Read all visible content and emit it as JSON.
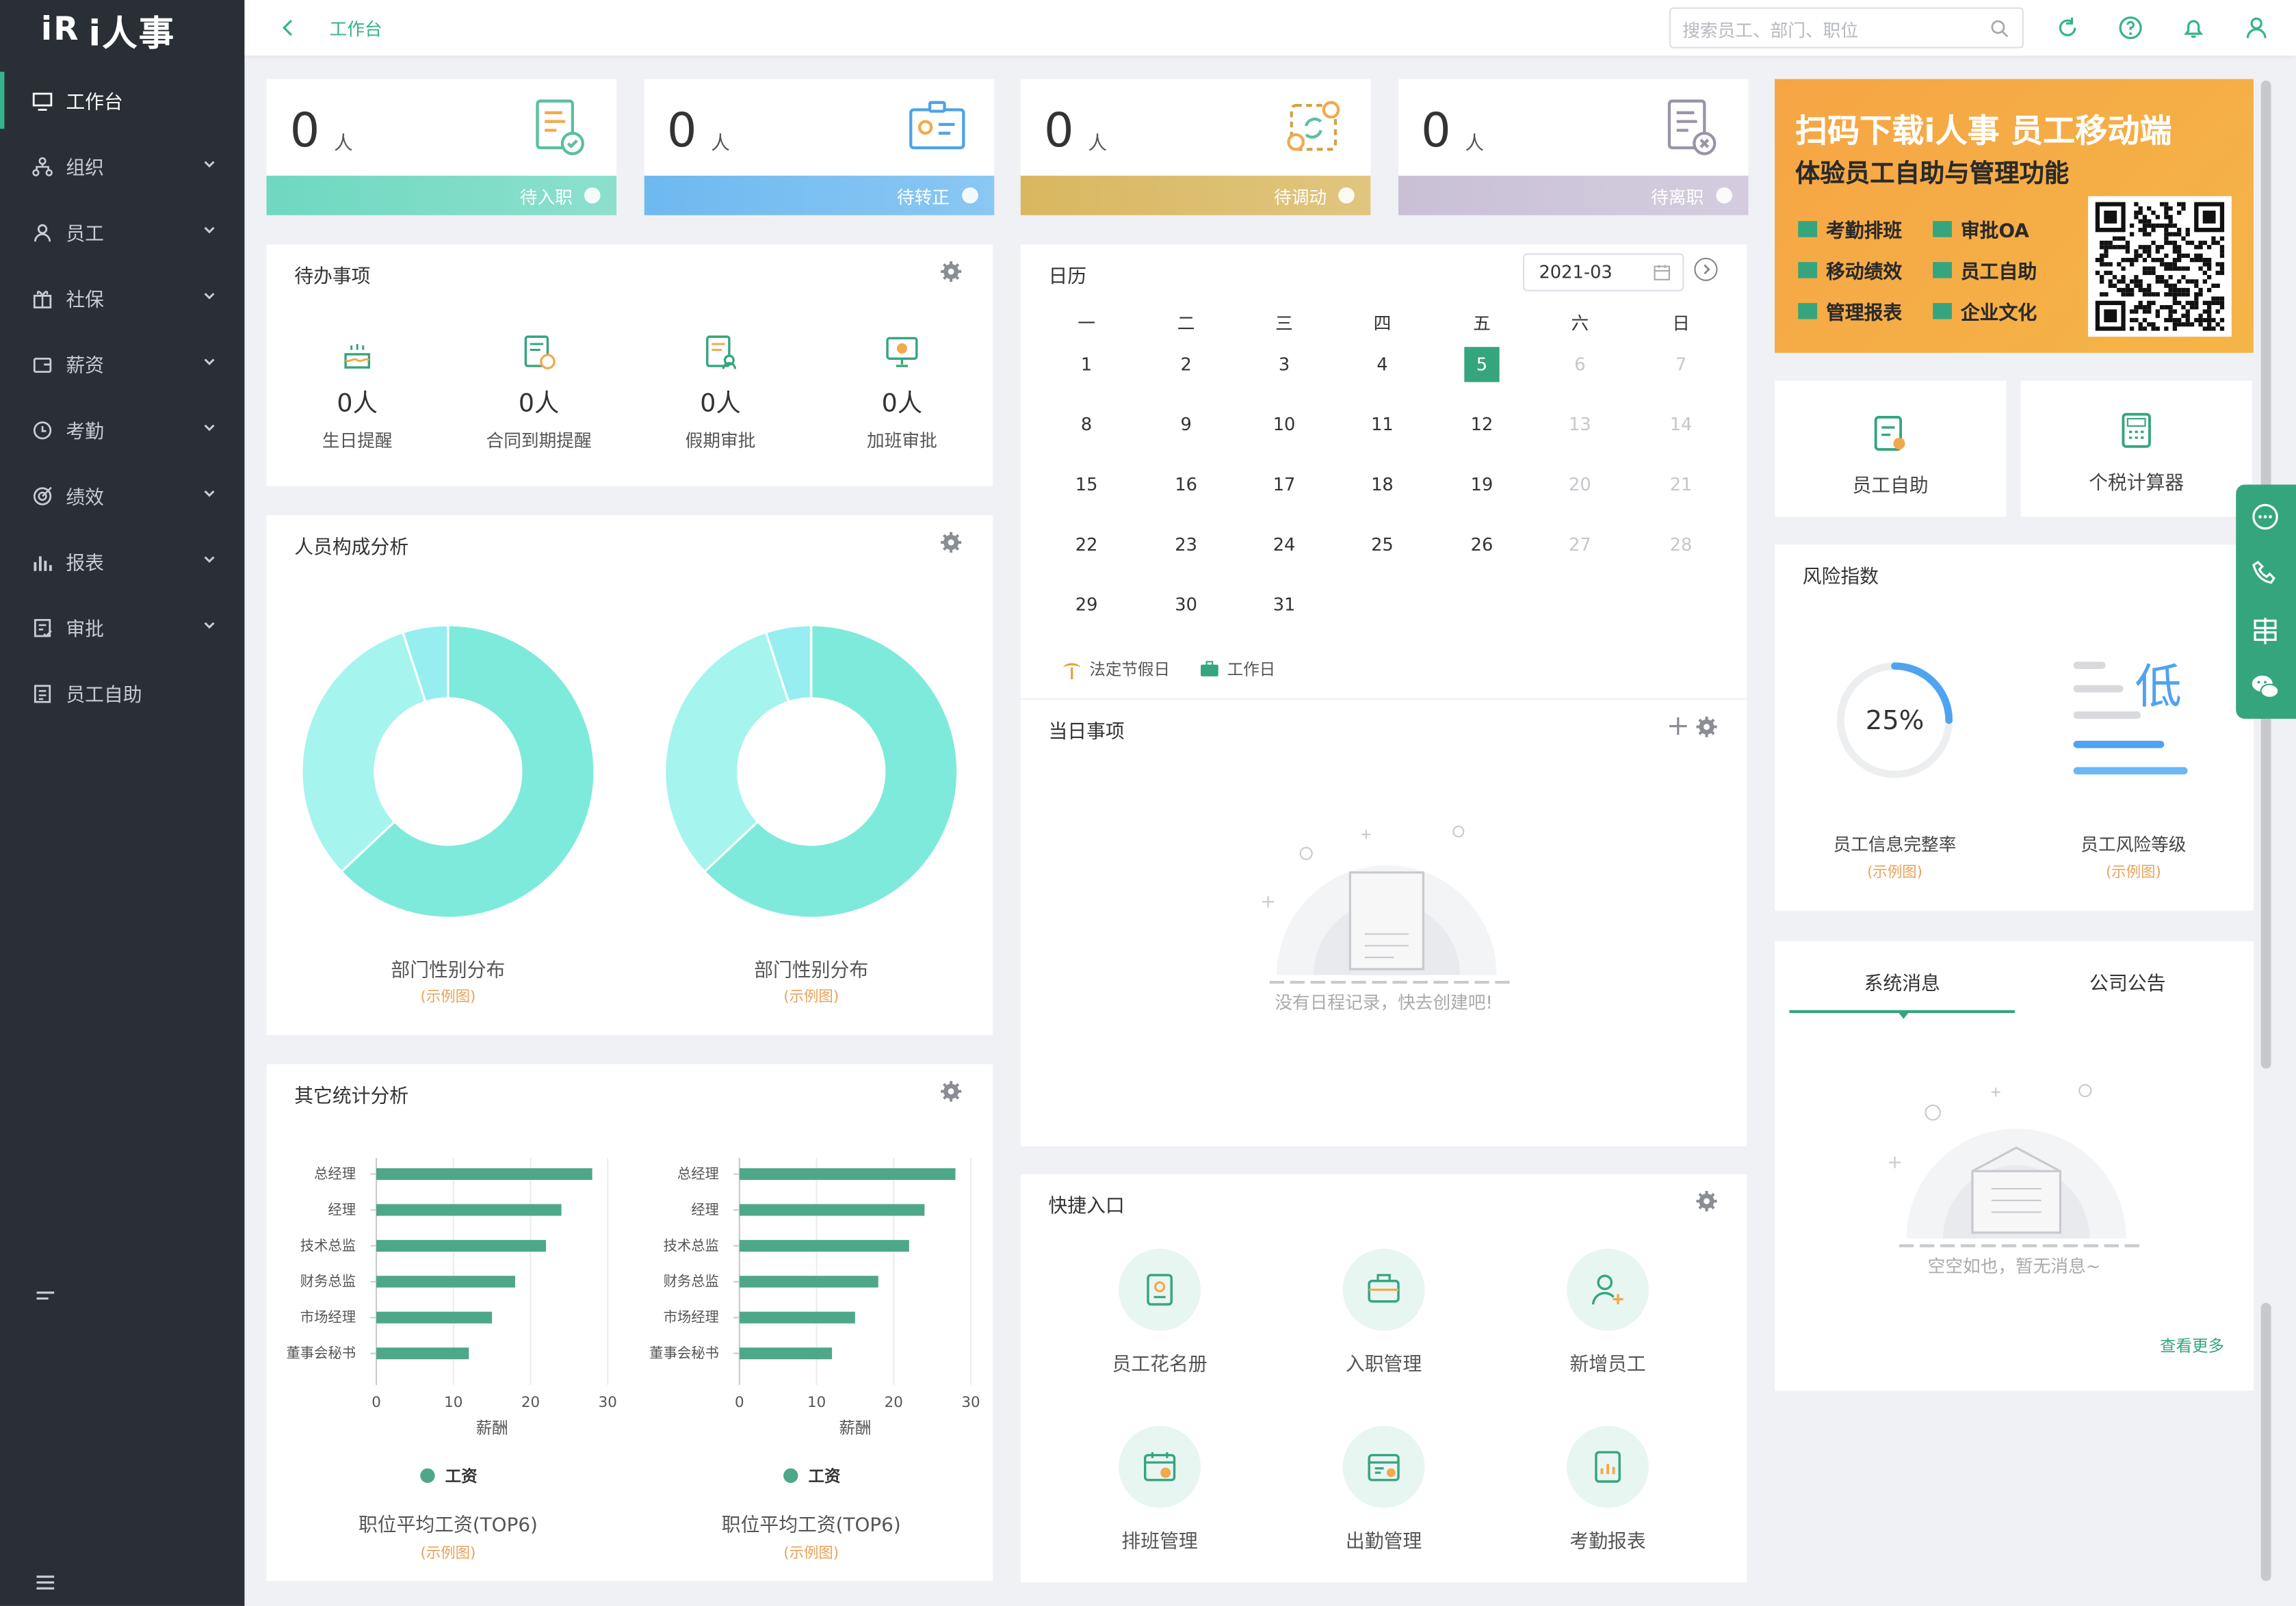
{
  "logo": {
    "mark": "iR",
    "text": "i人事"
  },
  "nav": [
    {
      "label": "工作台",
      "icon": "monitor-icon",
      "active": true
    },
    {
      "label": "组织",
      "icon": "org-icon"
    },
    {
      "label": "员工",
      "icon": "user-icon"
    },
    {
      "label": "社保",
      "icon": "gift-icon"
    },
    {
      "label": "薪资",
      "icon": "wallet-icon"
    },
    {
      "label": "考勤",
      "icon": "clock-icon"
    },
    {
      "label": "绩效",
      "icon": "target-icon"
    },
    {
      "label": "报表",
      "icon": "bar-chart-icon"
    },
    {
      "label": "审批",
      "icon": "approve-icon"
    },
    {
      "label": "员工自助",
      "icon": "self-service-icon"
    }
  ],
  "topbar": {
    "breadcrumb": "工作台",
    "search_placeholder": "搜索员工、部门、职位"
  },
  "stats": [
    {
      "num": "0",
      "unit": "人",
      "label": "待入职",
      "color": "#6fd8c0"
    },
    {
      "num": "0",
      "unit": "人",
      "label": "待转正",
      "color": "#6db9f0"
    },
    {
      "num": "0",
      "unit": "人",
      "label": "待调动",
      "color": "#d9b760"
    },
    {
      "num": "0",
      "unit": "人",
      "label": "待离职",
      "color": "#c9c0d6"
    }
  ],
  "todo": {
    "title": "待办事项",
    "items": [
      {
        "count": "0人",
        "label": "生日提醒"
      },
      {
        "count": "0人",
        "label": "合同到期提醒"
      },
      {
        "count": "0人",
        "label": "假期审批"
      },
      {
        "count": "0人",
        "label": "加班审批"
      }
    ]
  },
  "composition": {
    "title": "人员构成分析",
    "charts": [
      {
        "caption": "部门性别分布",
        "sub": "(示例图)"
      },
      {
        "caption": "部门性别分布",
        "sub": "(示例图)"
      }
    ]
  },
  "chart_data": [
    {
      "type": "pie",
      "slices": [
        {
          "value": 0.63,
          "color": "#7eeadb"
        },
        {
          "value": 0.32,
          "color": "#a5f4ee"
        },
        {
          "value": 0.05,
          "color": "#96eef0"
        }
      ]
    },
    {
      "type": "pie",
      "slices": [
        {
          "value": 0.63,
          "color": "#7eeadb"
        },
        {
          "value": 0.32,
          "color": "#a5f4ee"
        },
        {
          "value": 0.05,
          "color": "#96eef0"
        }
      ]
    },
    {
      "type": "bar",
      "orientation": "horizontal",
      "categories": [
        "总经理",
        "经理",
        "技术总监",
        "财务总监",
        "市场经理",
        "董事会秘书"
      ],
      "series": [
        {
          "name": "工资",
          "values": [
            28,
            24,
            22,
            18,
            15,
            12
          ]
        }
      ],
      "xlabel": "薪酬",
      "xlim": [
        0,
        30
      ],
      "xticks": [
        "0",
        "10",
        "20",
        "30"
      ],
      "title": "职位平均工资(TOP6)",
      "sub": "(示例图)"
    },
    {
      "type": "bar",
      "orientation": "horizontal",
      "categories": [
        "总经理",
        "经理",
        "技术总监",
        "财务总监",
        "市场经理",
        "董事会秘书"
      ],
      "series": [
        {
          "name": "工资",
          "values": [
            28,
            24,
            22,
            18,
            15,
            12
          ]
        }
      ],
      "xlabel": "薪酬",
      "xlim": [
        0,
        30
      ],
      "xticks": [
        "0",
        "10",
        "20",
        "30"
      ],
      "title": "职位平均工资(TOP6)",
      "sub": "(示例图)"
    }
  ],
  "other_stats": {
    "title": "其它统计分析"
  },
  "calendar": {
    "title": "日历",
    "month": "2021-03",
    "weekdays": [
      "一",
      "二",
      "三",
      "四",
      "五",
      "六",
      "日"
    ],
    "rows": [
      [
        "1",
        "2",
        "3",
        "4",
        "5",
        "6",
        "7"
      ],
      [
        "8",
        "9",
        "10",
        "11",
        "12",
        "13",
        "14"
      ],
      [
        "15",
        "16",
        "17",
        "18",
        "19",
        "20",
        "21"
      ],
      [
        "22",
        "23",
        "24",
        "25",
        "26",
        "27",
        "28"
      ],
      [
        "29",
        "30",
        "31"
      ]
    ],
    "today": "5",
    "legend_holiday": "法定节假日",
    "legend_workday": "工作日"
  },
  "today_events": {
    "title": "当日事项",
    "empty": "没有日程记录，快去创建吧!"
  },
  "quick": {
    "title": "快捷入口",
    "items": [
      "员工花名册",
      "入职管理",
      "新增员工",
      "排班管理",
      "出勤管理",
      "考勤报表"
    ]
  },
  "banner": {
    "line1": "扫码下载i人事 员工移动端",
    "line2": "体验员工自助与管理功能",
    "features": [
      "考勤排班",
      "审批OA",
      "移动绩效",
      "员工自助",
      "管理报表",
      "企业文化"
    ]
  },
  "tools": [
    "员工自助",
    "个税计算器"
  ],
  "risk": {
    "title": "风险指数",
    "percent": "25%",
    "percent_value": 0.25,
    "level": "低",
    "completeness_label": "员工信息完整率",
    "level_label": "员工风险等级",
    "sub": "(示例图)"
  },
  "messages": {
    "tab1": "系统消息",
    "tab2": "公司公告",
    "empty": "空空如也，暂无消息~",
    "more": "查看更多"
  }
}
